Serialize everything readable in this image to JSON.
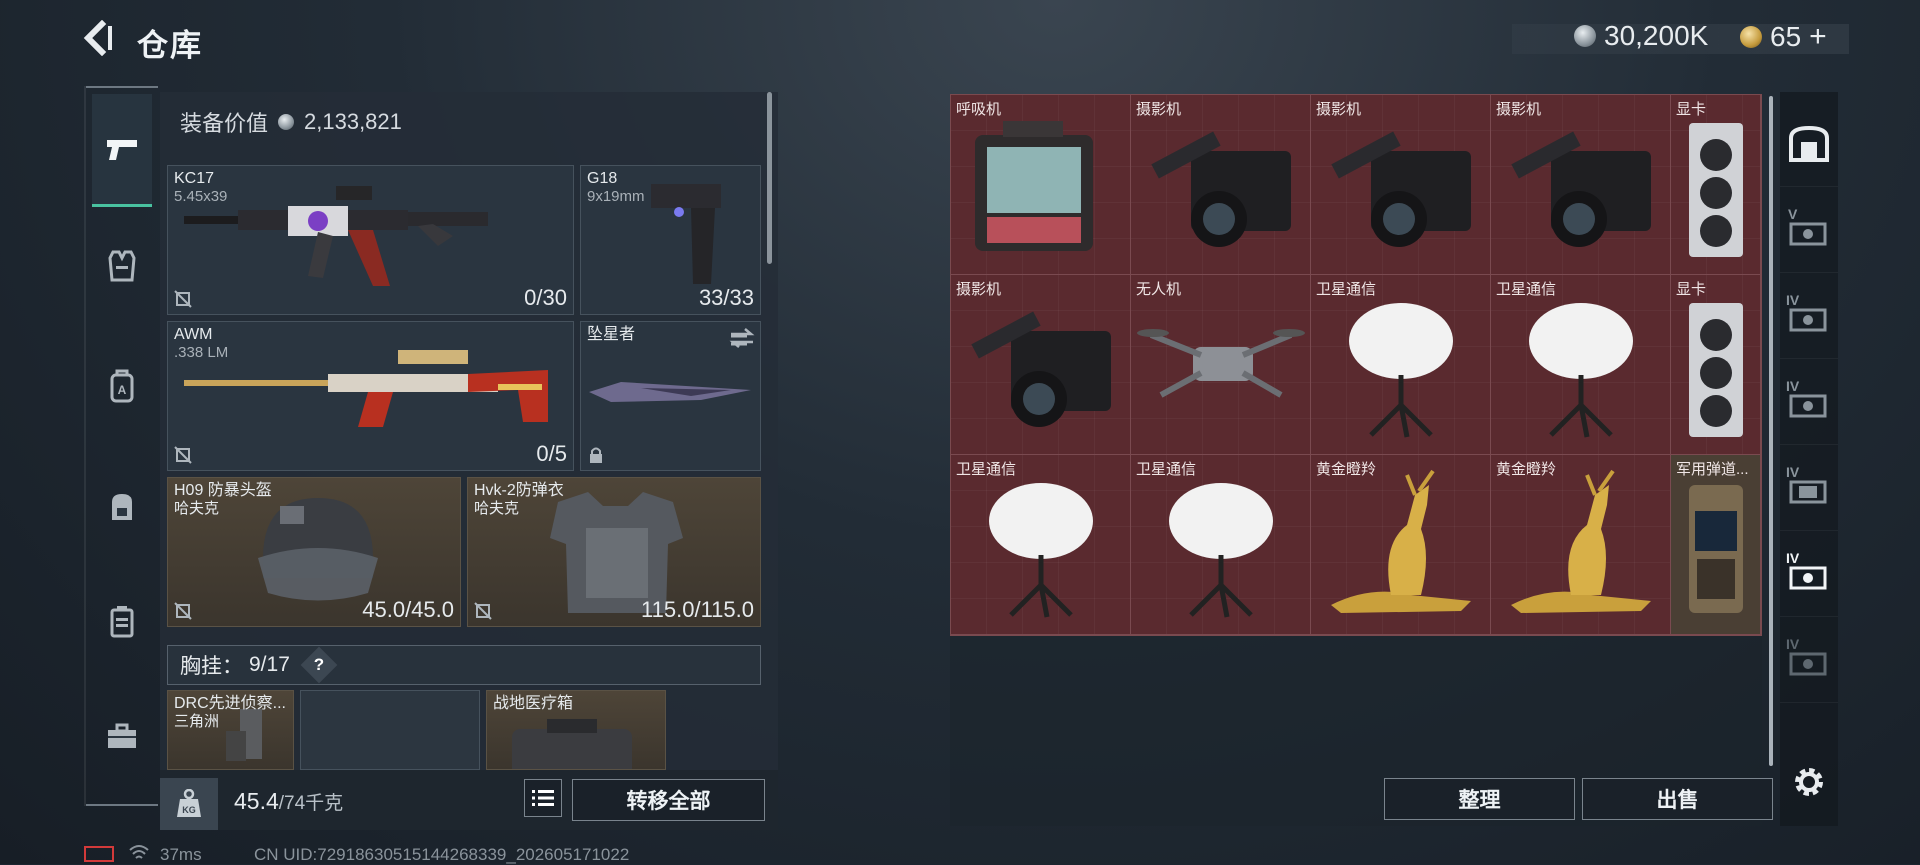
{
  "header": {
    "title": "仓库",
    "currency_amount": "30,200K",
    "premium_amount": "65",
    "premium_plus": "+"
  },
  "colors": {
    "accent": "#49c2a0",
    "grid_bg": "#5c2a30",
    "gold_cell": "#4a3f34"
  },
  "left_nav": {
    "items": [
      {
        "icon": "pistol-icon",
        "active": true
      },
      {
        "icon": "vest-icon"
      },
      {
        "icon": "backpack-a-icon"
      },
      {
        "icon": "backpack-icon"
      },
      {
        "icon": "case-icon"
      },
      {
        "icon": "toolbox-icon"
      }
    ]
  },
  "equipment": {
    "value_label": "装备价值",
    "value": "2,133,821",
    "slots": {
      "primary": {
        "name": "KC17",
        "caliber": "5.45x39",
        "ammo": "0/30"
      },
      "pistol": {
        "name": "G18",
        "caliber": "9x19mm",
        "ammo": "33/33"
      },
      "secondary": {
        "name": "AWM",
        "caliber": ".338 LM",
        "ammo": "0/5"
      },
      "melee": {
        "name": "坠星者"
      },
      "helmet": {
        "name": "H09 防暴头盔",
        "brand": "哈夫克",
        "durability": "45.0/45.0"
      },
      "armor": {
        "name": "Hvk-2防弹衣",
        "brand": "哈夫克",
        "durability": "115.0/115.0"
      }
    },
    "chest_rig_label": "胸挂：",
    "chest_rig_count": "9/17",
    "help_glyph": "?",
    "items": [
      {
        "name": "DRC先进侦察...",
        "sub": "三角洲"
      },
      {
        "name": "",
        "sub": ""
      },
      {
        "name": "战地医疗箱",
        "sub": ""
      }
    ],
    "weight_value": "45.4",
    "weight_total": "/74千克",
    "transfer_all_label": "转移全部"
  },
  "grid": {
    "items": [
      {
        "label": "呼吸机",
        "icon": "ventilator-icon"
      },
      {
        "label": "摄影机",
        "icon": "camera-icon"
      },
      {
        "label": "摄影机",
        "icon": "camera-icon"
      },
      {
        "label": "摄影机",
        "icon": "camera-icon"
      },
      {
        "label": "显卡",
        "icon": "gpu-icon"
      },
      {
        "label": "摄影机",
        "icon": "camera-icon"
      },
      {
        "label": "无人机",
        "icon": "drone-icon"
      },
      {
        "label": "卫星通信",
        "icon": "satellite-dish-icon"
      },
      {
        "label": "卫星通信",
        "icon": "satellite-dish-icon"
      },
      {
        "label": "显卡",
        "icon": "gpu-icon"
      },
      {
        "label": "卫星通信",
        "icon": "satellite-dish-icon"
      },
      {
        "label": "卫星通信",
        "icon": "satellite-dish-icon"
      },
      {
        "label": "黄金瞪羚",
        "icon": "golden-gazelle-icon"
      },
      {
        "label": "黄金瞪羚",
        "icon": "golden-gazelle-icon"
      },
      {
        "label": "军用弹道...",
        "icon": "ballistic-computer-icon"
      }
    ]
  },
  "actions": {
    "sort_label": "整理",
    "sell_label": "出售"
  },
  "right_nav": {
    "labels": [
      "V",
      "IV",
      "IV",
      "IV",
      "IV",
      "IV"
    ]
  },
  "status": {
    "ping": "37ms",
    "uid": "CN UID:729186305151442683​39_202605171022"
  }
}
